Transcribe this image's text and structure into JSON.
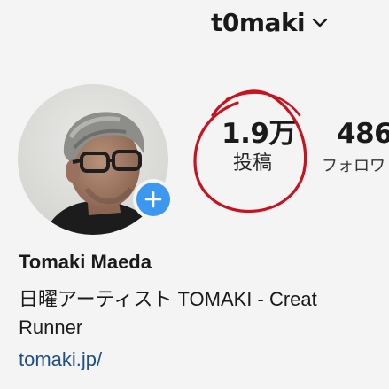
{
  "header": {
    "username": "t0maki",
    "dropdown_icon": "chevron-down-icon"
  },
  "profile": {
    "avatar_icon": "profile-photo",
    "add_story_icon": "plus-icon",
    "full_name": "Tomaki Maeda",
    "bio_line1": "日曜アーティスト TOMAKI - Creat",
    "bio_line2": "Runner",
    "link": "tomaki.jp/"
  },
  "stats": {
    "posts_count": "1.9万",
    "posts_label": "投稿",
    "followers_count": "486",
    "followers_label": "フォロワ"
  },
  "annotation": {
    "circle_color": "#c8121f"
  },
  "colors": {
    "accent_blue": "#3b97f0",
    "link": "#1f4f86"
  }
}
